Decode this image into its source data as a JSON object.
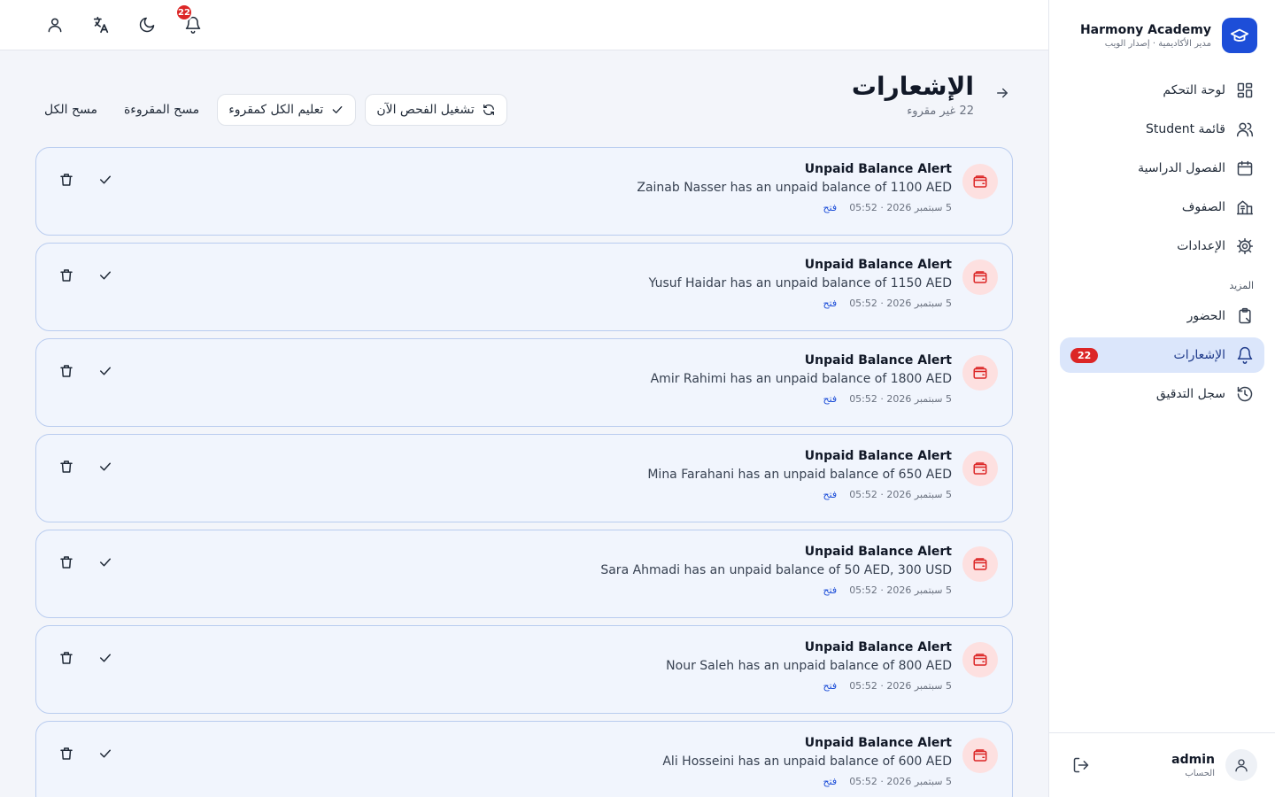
{
  "brand": {
    "name": "Harmony Academy",
    "subtitle": "مدير الأكاديمية · إصدار الويب"
  },
  "sidebar": {
    "items": [
      {
        "label": "لوحة التحكم",
        "icon": "dashboard-icon"
      },
      {
        "label": "قائمة Student",
        "icon": "users-icon"
      },
      {
        "label": "الفصول الدراسية",
        "icon": "calendar-icon"
      },
      {
        "label": "الصفوف",
        "icon": "building-icon"
      },
      {
        "label": "الإعدادات",
        "icon": "gear-icon"
      }
    ],
    "section_label": "المزيد",
    "more_items": [
      {
        "label": "الحضور",
        "icon": "clipboard-icon"
      },
      {
        "label": "الإشعارات",
        "icon": "bell-icon",
        "badge": "22",
        "active": true
      },
      {
        "label": "سجل التدقيق",
        "icon": "history-icon"
      }
    ]
  },
  "account": {
    "name": "admin",
    "subtitle": "الحساب"
  },
  "topbar": {
    "bell_badge": "22"
  },
  "page": {
    "title": "الإشعارات",
    "unread": "22 غير مقروء"
  },
  "actions": {
    "run_check": "تشغيل الفحص الآن",
    "mark_all_read": "تعليم الكل كمقروء",
    "clear_read": "مسح المقروءة",
    "clear_all": "مسح الكل"
  },
  "notifications": [
    {
      "title": "Unpaid Balance Alert",
      "message": "Zainab Nasser has an unpaid balance of 1100 AED",
      "time": "5 سبتمبر 2026 · 05:52",
      "link": "فتح"
    },
    {
      "title": "Unpaid Balance Alert",
      "message": "Yusuf Haidar has an unpaid balance of 1150 AED",
      "time": "5 سبتمبر 2026 · 05:52",
      "link": "فتح"
    },
    {
      "title": "Unpaid Balance Alert",
      "message": "Amir Rahimi has an unpaid balance of 1800 AED",
      "time": "5 سبتمبر 2026 · 05:52",
      "link": "فتح"
    },
    {
      "title": "Unpaid Balance Alert",
      "message": "Mina Farahani has an unpaid balance of 650 AED",
      "time": "5 سبتمبر 2026 · 05:52",
      "link": "فتح"
    },
    {
      "title": "Unpaid Balance Alert",
      "message": "Sara Ahmadi has an unpaid balance of 50 AED, 300 USD",
      "time": "5 سبتمبر 2026 · 05:52",
      "link": "فتح"
    },
    {
      "title": "Unpaid Balance Alert",
      "message": "Nour Saleh has an unpaid balance of 800 AED",
      "time": "5 سبتمبر 2026 · 05:52",
      "link": "فتح"
    },
    {
      "title": "Unpaid Balance Alert",
      "message": "Ali Hosseini has an unpaid balance of 600 AED",
      "time": "5 سبتمبر 2026 · 05:52",
      "link": "فتح"
    }
  ],
  "colors": {
    "accent": "#1d4ed8",
    "badge": "#dc2626",
    "card_bg": "#f1f5fd",
    "card_border": "#b9ccef",
    "alert_icon_bg": "#fde0e0",
    "alert_icon": "#dc2626"
  }
}
